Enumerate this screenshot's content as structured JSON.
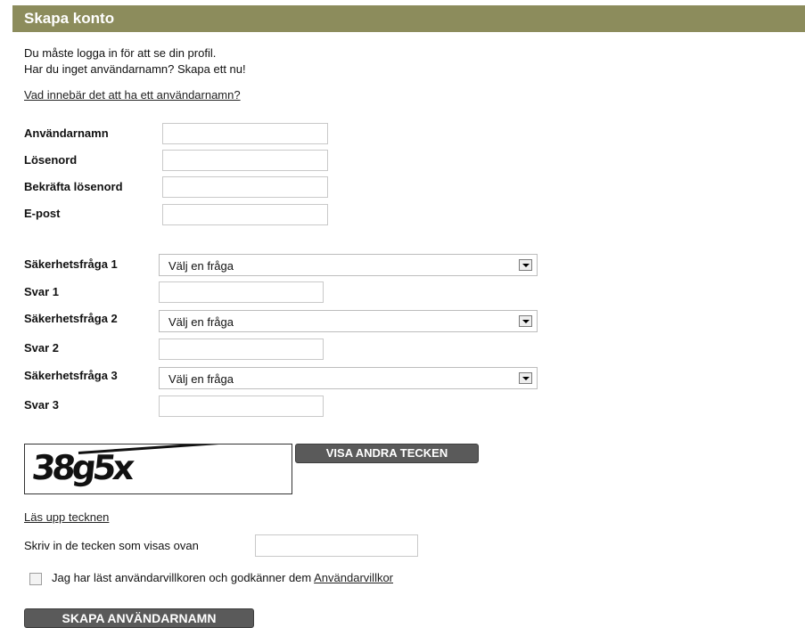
{
  "header": {
    "title": "Skapa konto"
  },
  "intro": {
    "line1": "Du måste logga in för att se din profil.",
    "line2": "Har du inget användarnamn? Skapa ett nu!",
    "info_link": "Vad innebär det att ha ett användarnamn?"
  },
  "fields": {
    "username_label": "Användarnamn",
    "password_label": "Lösenord",
    "confirm_password_label": "Bekräfta lösenord",
    "email_label": "E-post",
    "username_value": "",
    "password_value": "",
    "confirm_password_value": "",
    "email_value": ""
  },
  "security": {
    "q1_label": "Säkerhetsfråga 1",
    "q1_selected": "Välj en fråga",
    "a1_label": "Svar 1",
    "q2_label": "Säkerhetsfråga 2",
    "q2_selected": "Välj en fråga",
    "a2_label": "Svar 2",
    "q3_label": "Säkerhetsfråga 3",
    "q3_selected": "Välj en fråga",
    "a3_label": "Svar 3"
  },
  "captcha": {
    "image_text": "38g5x",
    "refresh_button": "VISA ANDRA TECKEN",
    "audio_link": "Läs upp tecknen",
    "input_label": "Skriv in de tecken som visas ovan",
    "input_value": ""
  },
  "terms": {
    "checkbox_label": "Jag har läst användarvillkoren och godkänner dem",
    "terms_link": "Användarvillkor",
    "checked": false
  },
  "submit": {
    "label": "SKAPA ANVÄNDARNAMN"
  },
  "colors": {
    "header_bg": "#8c8c5c",
    "button_bg": "#5a5a5a"
  },
  "icons": {
    "select_arrow": "chevron-down-icon"
  }
}
